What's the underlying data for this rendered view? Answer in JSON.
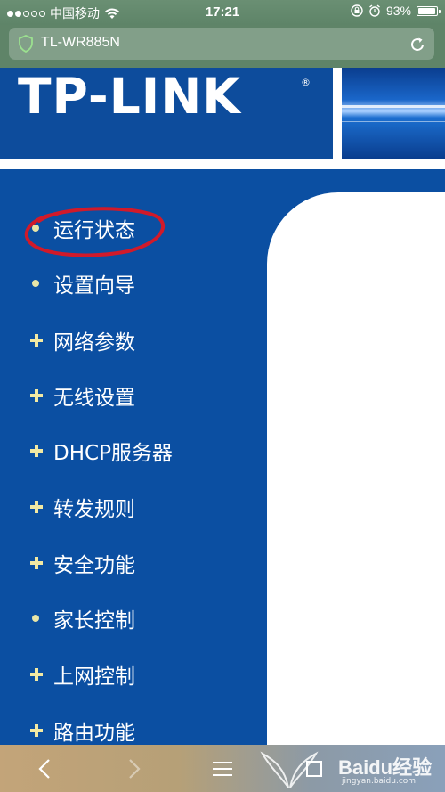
{
  "status_bar": {
    "carrier": "中国移动",
    "time": "17:21",
    "battery_percent": "93%",
    "battery_level": 0.93
  },
  "address_bar": {
    "url": "TL-WR885N"
  },
  "banner": {
    "logo": "TP-LINK",
    "reg": "®"
  },
  "menu": {
    "items": [
      {
        "label": "运行状态",
        "bullet": "dot"
      },
      {
        "label": "设置向导",
        "bullet": "dot"
      },
      {
        "label": "网络参数",
        "bullet": "plus"
      },
      {
        "label": "无线设置",
        "bullet": "plus"
      },
      {
        "label": "DHCP服务器",
        "bullet": "plus"
      },
      {
        "label": "转发规则",
        "bullet": "plus"
      },
      {
        "label": "安全功能",
        "bullet": "plus"
      },
      {
        "label": "家长控制",
        "bullet": "dot"
      },
      {
        "label": "上网控制",
        "bullet": "plus"
      },
      {
        "label": "路由功能",
        "bullet": "plus"
      }
    ]
  },
  "watermark": {
    "brand": "Baidu经验",
    "site": "jingyan.baidu.com"
  },
  "colors": {
    "page_blue": "#0b4fa2",
    "annotation_red": "#d11a2a",
    "bullet_yellow": "#f2e9a3"
  }
}
